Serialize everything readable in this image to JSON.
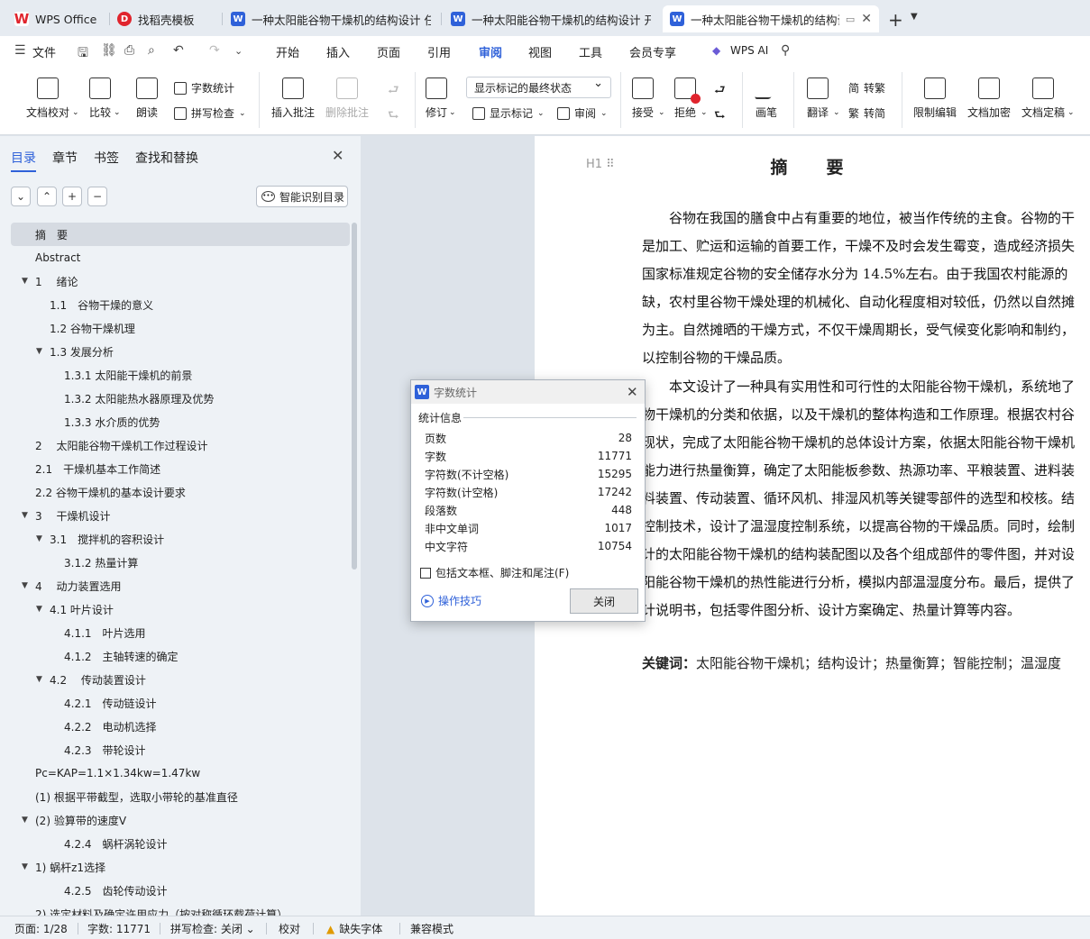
{
  "tabs": [
    {
      "label": "WPS Office",
      "icon": "wps-logo-icon"
    },
    {
      "label": "找稻壳模板",
      "icon": "template-icon"
    },
    {
      "label": "一种太阳能谷物干燥机的结构设计 任",
      "icon": "doc-icon"
    },
    {
      "label": "一种太阳能谷物干燥机的结构设计 开",
      "icon": "doc-icon"
    },
    {
      "label": "一种太阳能谷物干燥机的结构设计",
      "icon": "doc-icon",
      "active": true
    }
  ],
  "menu": {
    "file": "文件",
    "items": [
      "开始",
      "插入",
      "页面",
      "引用",
      "审阅",
      "视图",
      "工具",
      "会员专享"
    ],
    "active": "审阅",
    "ai": "WPS AI"
  },
  "ribbon": {
    "doc_check": "文档校对",
    "compare": "比较",
    "read_aloud": "朗读",
    "word_count": "字数统计",
    "spell_check": "拼写检查",
    "insert_comment": "插入批注",
    "delete_comment": "删除批注",
    "revise": "修订",
    "markup_state": "显示标记的最终状态",
    "show_markup": "显示标记",
    "review": "审阅",
    "accept": "接受",
    "reject": "拒绝",
    "pen": "画笔",
    "translate": "翻译",
    "to_traditional": "转繁",
    "to_simplified": "转简",
    "restrict_edit": "限制编辑",
    "encrypt": "文档加密",
    "finalize": "文档定稿"
  },
  "nav": {
    "tabs": [
      "目录",
      "章节",
      "书签",
      "查找和替换"
    ],
    "active_tab": "目录",
    "smart_button": "智能识别目录",
    "toc": [
      {
        "label": "摘　要",
        "level": 1,
        "selected": true
      },
      {
        "label": "Abstract",
        "level": 1
      },
      {
        "label": "1　 绪论",
        "level": 1,
        "expand": true
      },
      {
        "label": "1.1　谷物干燥的意义",
        "level": 2
      },
      {
        "label": "1.2  谷物干燥机理",
        "level": 2
      },
      {
        "label": "1.3 发展分析",
        "level": 2,
        "expand": true
      },
      {
        "label": "1.3.1  太阳能干燥机的前景",
        "level": 3
      },
      {
        "label": "1.3.2  太阳能热水器原理及优势",
        "level": 3
      },
      {
        "label": "1.3.3  水介质的优势",
        "level": 3
      },
      {
        "label": "2　 太阳能谷物干燥机工作过程设计",
        "level": 1
      },
      {
        "label": "2.1　干燥机基本工作简述",
        "level": 1
      },
      {
        "label": "2.2 谷物干燥机的基本设计要求",
        "level": 1
      },
      {
        "label": "3　 干燥机设计",
        "level": 1,
        "expand": true
      },
      {
        "label": "3.1　搅拌机的容积设计",
        "level": 2,
        "expand": true
      },
      {
        "label": "3.1.2  热量计算",
        "level": 3
      },
      {
        "label": "4　 动力装置选用",
        "level": 1,
        "expand": true
      },
      {
        "label": "4.1 叶片设计",
        "level": 2,
        "expand": true
      },
      {
        "label": "4.1.1　叶片选用",
        "level": 3
      },
      {
        "label": "4.1.2　主轴转速的确定",
        "level": 3
      },
      {
        "label": "4.2　 传动装置设计",
        "level": 2,
        "expand": true
      },
      {
        "label": "4.2.1　传动链设计",
        "level": 3
      },
      {
        "label": "4.2.2　电动机选择",
        "level": 3
      },
      {
        "label": "4.2.3　带轮设计",
        "level": 3
      },
      {
        "label": "Pc=KAP=1.1×1.34kw=1.47kw",
        "level": 1
      },
      {
        "label": "(1) 根据平带截型，选取小带轮的基准直径",
        "level": 1
      },
      {
        "label": "(2) 验算带的速度V",
        "level": 1,
        "expand": true
      },
      {
        "label": "4.2.4　蜗杆涡轮设计",
        "level": 3
      },
      {
        "label": "1) 蜗杆z1选择",
        "level": 1,
        "expand": true
      },
      {
        "label": "4.2.5　齿轮传动设计",
        "level": 3
      },
      {
        "label": "2) 选定材料及确定许用应力（按对称循环载荷计算）",
        "level": 1
      }
    ]
  },
  "document": {
    "heading_mark": "H1",
    "title": "摘　要",
    "para1": [
      "　　谷物在我国的膳食中占有重要的地位，被当作传统的主食。谷物的干",
      "是加工、贮运和运输的首要工作，干燥不及时会发生霉变，造成经济损失",
      "国家标准规定谷物的安全储存水分为 14.5%左右。由于我国农村能源的",
      "缺，农村里谷物干燥处理的机械化、自动化程度相对较低，仍然以自然摊",
      "为主。自然摊晒的干燥方式，不仅干燥周期长，受气候变化影响和制约，",
      "以控制谷物的干燥品质。"
    ],
    "para2": [
      "　　本文设计了一种具有实用性和可行性的太阳能谷物干燥机，系统地了",
      "物干燥机的分类和依据，以及干燥机的整体构造和工作原理。根据农村谷",
      "现状，完成了太阳能谷物干燥机的总体设计方案，依据太阳能谷物干燥机",
      "能力进行热量衡算，确定了太阳能板参数、热源功率、平粮装置、进料装",
      "料装置、传动装置、循环风机、排湿风机等关键零部件的选型和校核。结",
      "控制技术，设计了温湿度控制系统，以提高谷物的干燥品质。同时，绘制",
      "计的太阳能谷物干燥机的结构装配图以及各个组成部件的零件图，并对设",
      "阳能谷物干燥机的热性能进行分析，模拟内部温湿度分布。最后，提供了",
      "计说明书，包括零件图分析、设计方案确定、热量计算等内容。"
    ],
    "keywords_label": "关键词：",
    "keywords": "太阳能谷物干燥机；结构设计；热量衡算；智能控制；温湿度"
  },
  "dialog": {
    "title": "字数统计",
    "group": "统计信息",
    "stats": [
      {
        "label": "页数",
        "value": "28"
      },
      {
        "label": "字数",
        "value": "11771"
      },
      {
        "label": "字符数(不计空格)",
        "value": "15295"
      },
      {
        "label": "字符数(计空格)",
        "value": "17242"
      },
      {
        "label": "段落数",
        "value": "448"
      },
      {
        "label": "非中文单词",
        "value": "1017"
      },
      {
        "label": "中文字符",
        "value": "10754"
      }
    ],
    "checkbox": "包括文本框、脚注和尾注(F)",
    "tips": "操作技巧",
    "close": "关闭"
  },
  "status": {
    "page": "页面: 1/28",
    "words": "字数: 11771",
    "spell": "拼写检查: 关闭",
    "proof": "校对",
    "missing_font": "缺失字体",
    "compat": "兼容模式"
  },
  "colors": {
    "accent": "#2f61d9",
    "wps_red": "#e0242d"
  }
}
